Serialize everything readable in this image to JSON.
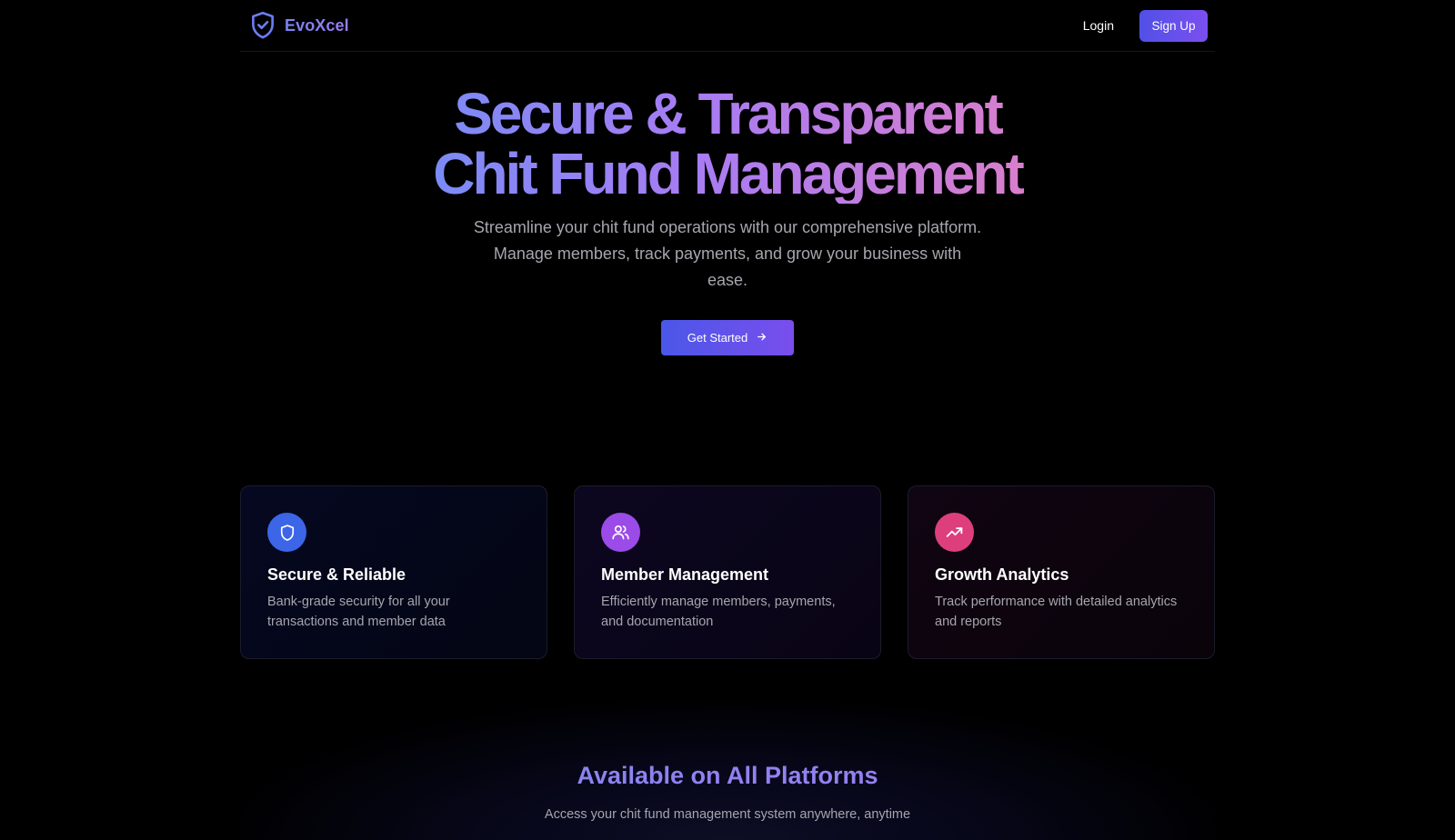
{
  "header": {
    "brand_name": "EvoXcel",
    "brand_icon": "shield-check-icon",
    "login_label": "Login",
    "signup_label": "Sign Up"
  },
  "hero": {
    "title_line1": "Secure & Transparent",
    "title_line2": "Chit Fund Management",
    "subtitle": "Streamline your chit fund operations with our comprehensive platform. Manage members, track payments, and grow your business with ease.",
    "cta_label": "Get Started",
    "cta_icon": "arrow-right-icon"
  },
  "features": [
    {
      "icon": "shield-icon",
      "title": "Secure & Reliable",
      "description": "Bank-grade security for all your transactions and member data",
      "icon_color": "#3c65e8"
    },
    {
      "icon": "users-icon",
      "title": "Member Management",
      "description": "Efficiently manage members, payments, and documentation",
      "icon_color": "#9b4be8"
    },
    {
      "icon": "trending-up-icon",
      "title": "Growth Analytics",
      "description": "Track performance with detailed analytics and reports",
      "icon_color": "#dd3f7d"
    }
  ],
  "platforms": {
    "title": "Available on All Platforms",
    "subtitle": "Access your chit fund management system anywhere, anytime"
  },
  "colors": {
    "background": "#000000",
    "accent_start": "#4a57e8",
    "accent_end": "#7a4eed",
    "gradient_pink": "#e37ec4"
  }
}
